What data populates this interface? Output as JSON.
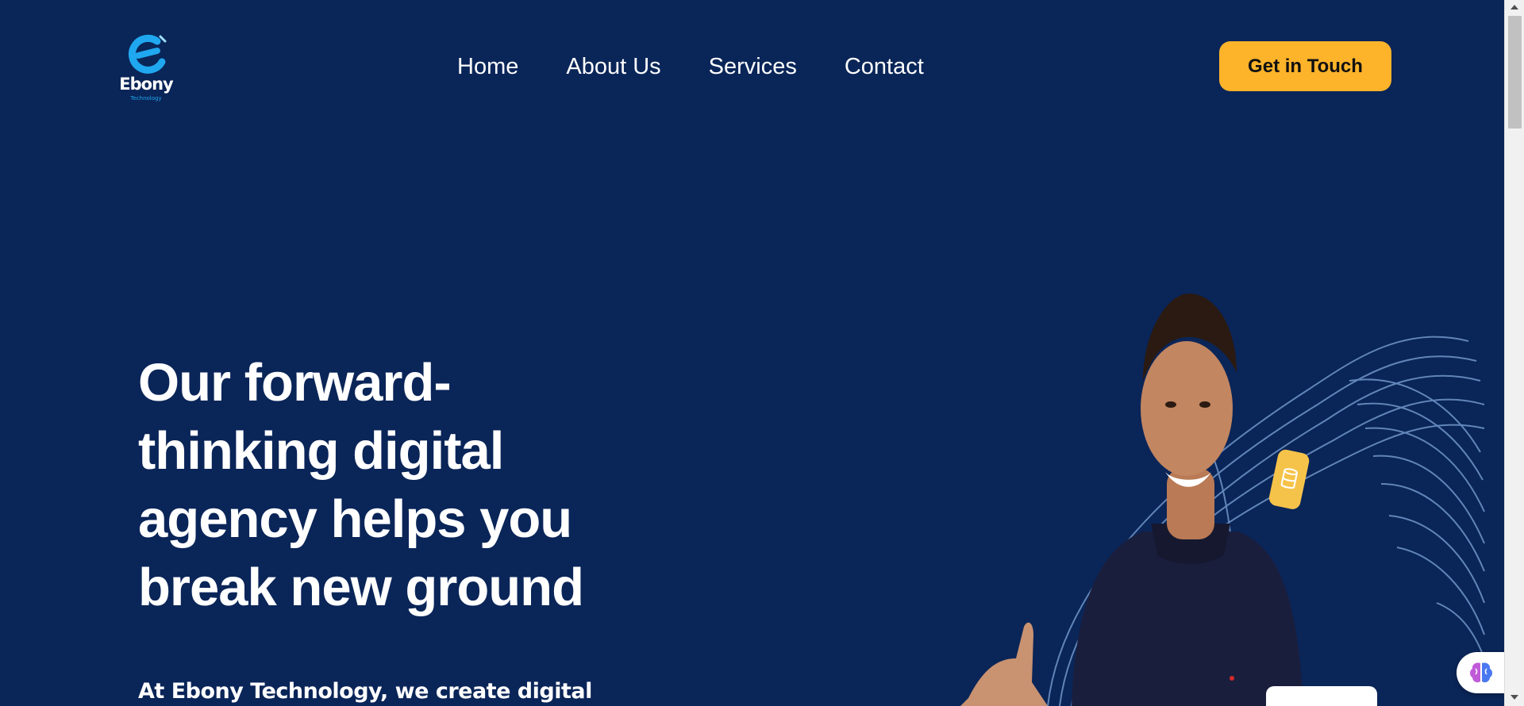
{
  "brand": {
    "name": "Ebony",
    "tagline": "Technology"
  },
  "nav": {
    "items": [
      {
        "label": "Home"
      },
      {
        "label": "About Us"
      },
      {
        "label": "Services"
      },
      {
        "label": "Contact"
      }
    ]
  },
  "header": {
    "cta_label": "Get in Touch"
  },
  "hero": {
    "title": "Our forward-thinking digital agency helps you break new ground",
    "subtitle": "At Ebony Technology, we create digital"
  },
  "icons": {
    "logo": "ebony-e-logo-icon",
    "assistant": "brain-icon",
    "coin": "coin-stack-icon"
  },
  "colors": {
    "background": "#0a2558",
    "accent": "#fdb32a",
    "logo_blue": "#1fa7ef"
  }
}
